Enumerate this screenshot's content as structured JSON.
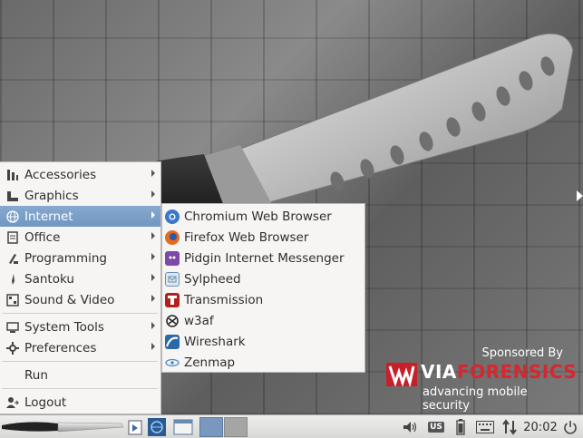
{
  "main_menu": {
    "items": [
      {
        "label": "Accessories",
        "icon": "accessories-icon"
      },
      {
        "label": "Graphics",
        "icon": "graphics-icon"
      },
      {
        "label": "Internet",
        "icon": "internet-globe-icon"
      },
      {
        "label": "Office",
        "icon": "office-icon"
      },
      {
        "label": "Programming",
        "icon": "programming-icon"
      },
      {
        "label": "Santoku",
        "icon": "santoku-knife-icon"
      },
      {
        "label": "Sound & Video",
        "icon": "sound-video-icon"
      },
      {
        "label": "System Tools",
        "icon": "system-tools-icon"
      },
      {
        "label": "Preferences",
        "icon": "preferences-gear-icon"
      },
      {
        "label": "Run",
        "icon": ""
      },
      {
        "label": "Logout",
        "icon": "logout-icon"
      }
    ],
    "active_item": "Internet"
  },
  "internet_submenu": {
    "items": [
      {
        "label": "Chromium Web Browser",
        "icon": "chromium-icon",
        "color": "#3a78c8"
      },
      {
        "label": "Firefox Web Browser",
        "icon": "firefox-icon",
        "color": "#e66a1f"
      },
      {
        "label": "Pidgin Internet Messenger",
        "icon": "pidgin-icon",
        "color": "#7b4aa8"
      },
      {
        "label": "Sylpheed",
        "icon": "sylpheed-icon",
        "color": "#6a8fb6"
      },
      {
        "label": "Transmission",
        "icon": "transmission-icon",
        "color": "#b02020"
      },
      {
        "label": "w3af",
        "icon": "w3af-icon",
        "color": "#222222"
      },
      {
        "label": "Wireshark",
        "icon": "wireshark-icon",
        "color": "#2a6aa8"
      },
      {
        "label": "Zenmap",
        "icon": "zenmap-eye-icon",
        "color": "#4a8ac8"
      }
    ]
  },
  "sponsor": {
    "by_text": "Sponsored By",
    "brand_via": "VIA",
    "brand_forensics": "FORENSICS",
    "tagline": "advancing mobile security"
  },
  "panel": {
    "keyboard_layout": "US",
    "clock": "20:02"
  },
  "colors": {
    "menu_bg": "#f6f5f3",
    "active_highlight": "#7a9fc8",
    "brand_red": "#d8262f"
  }
}
